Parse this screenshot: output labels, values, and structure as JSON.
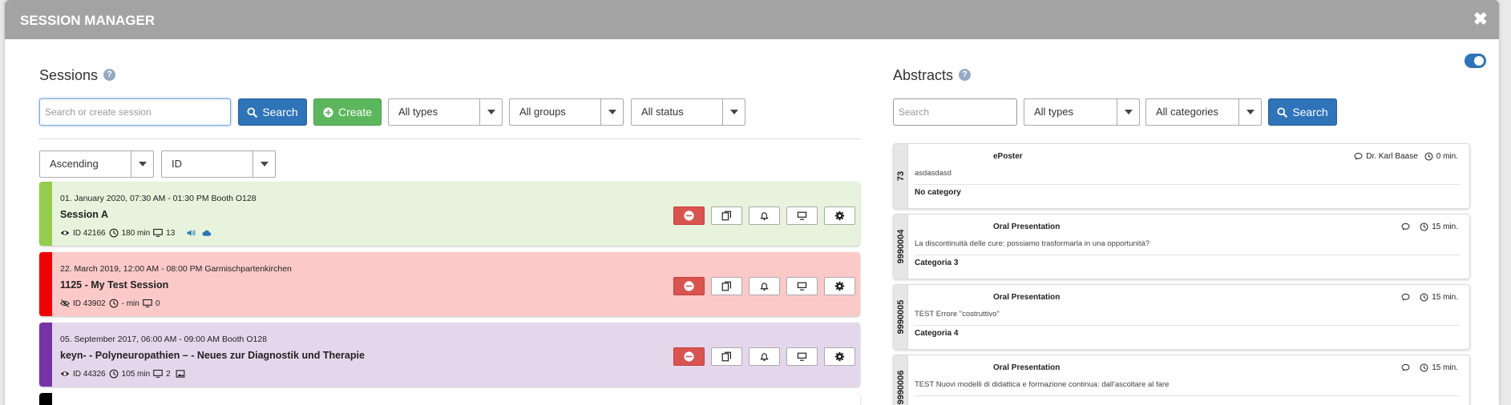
{
  "modal": {
    "title": "SESSION MANAGER",
    "close": "✖"
  },
  "sessions": {
    "heading": "Sessions",
    "help": "?",
    "search_placeholder": "Search or create session",
    "search_label": "Search",
    "create_label": "Create",
    "type_filter": "All types",
    "group_filter": "All groups",
    "status_filter": "All status",
    "sort_order": "Ascending",
    "sort_field": "ID",
    "items": [
      {
        "date": "01. January 2020, 07:30 AM - 01:30 PM Booth O128",
        "name": "Session A",
        "id": "ID 42166",
        "duration": "180 min",
        "screens": "13",
        "bar_color": "#94cc4e",
        "bg_color": "#e7f3dc"
      },
      {
        "date": "22. March 2019, 12:00 AM - 08:00 PM Garmischpartenkirchen",
        "name": "1125 - My Test Session",
        "id": "ID 43902",
        "duration": "- min",
        "screens": "0",
        "bar_color": "#ee0000",
        "bg_color": "#fcc9c9"
      },
      {
        "date": "05. September 2017, 06:00 AM - 09:00 AM Booth O128",
        "name": "keyn- - Polyneuropathien – - Neues zur Diagnostik und Therapie",
        "id": "ID 44326",
        "duration": "105 min",
        "screens": "2",
        "bar_color": "#7434a6",
        "bg_color": "#e4d7ec"
      }
    ]
  },
  "abstracts": {
    "heading": "Abstracts",
    "help": "?",
    "search_placeholder": "Search",
    "type_filter": "All types",
    "category_filter": "All categories",
    "search_label": "Search",
    "items": [
      {
        "id": "73",
        "type": "ePoster",
        "author": "Dr. Karl Baase",
        "duration": "0 min.",
        "title": "asdasdasd",
        "category": "No category"
      },
      {
        "id": "9990004",
        "type": "Oral Presentation",
        "author": "",
        "duration": "15 min.",
        "title": "La discontinuità delle cure: possiamo trasformarla in una opportunità?",
        "category": "Categoria 3"
      },
      {
        "id": "9990005",
        "type": "Oral Presentation",
        "author": "",
        "duration": "15 min.",
        "title": "TEST Errore \"costruttivo\"",
        "category": "Categoria 4"
      },
      {
        "id": "9990006",
        "type": "Oral Presentation",
        "author": "",
        "duration": "15 min.",
        "title": "TEST Nuovi modelli di didattica e formazione continua: dall'ascoltare al fare",
        "category": ""
      }
    ]
  },
  "colors": {
    "primary": "#2f73b8",
    "success": "#5cb65c",
    "danger": "#d9534f",
    "header": "#a3a3a3"
  }
}
